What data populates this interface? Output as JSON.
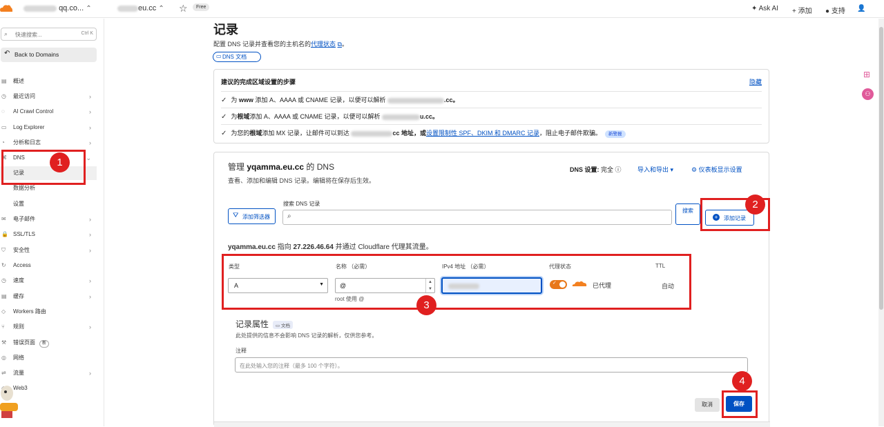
{
  "topbar": {
    "account": "qq.co...",
    "zone": "eu.cc",
    "free_badge": "Free",
    "ask_ai": "Ask AI",
    "add": "添加",
    "support": "支持"
  },
  "sidebar": {
    "search_placeholder": "快速搜索...",
    "search_shortcut": "Ctrl K",
    "back": "Back to Domains",
    "items": [
      {
        "label": "概述"
      },
      {
        "label": "最近访问"
      },
      {
        "label": "AI Crawl Control"
      },
      {
        "label": "Log Explorer"
      },
      {
        "label": "分析和日志"
      },
      {
        "label": "DNS"
      },
      {
        "label": "记录"
      },
      {
        "label": "数据分析"
      },
      {
        "label": "设置"
      },
      {
        "label": "电子邮件"
      },
      {
        "label": "SSL/TLS"
      },
      {
        "label": "安全性"
      },
      {
        "label": "Access"
      },
      {
        "label": "速度"
      },
      {
        "label": "缓存"
      },
      {
        "label": "Workers 路由"
      },
      {
        "label": "规则"
      },
      {
        "label": "错误页面"
      },
      {
        "label": "网络"
      },
      {
        "label": "流量"
      },
      {
        "label": "Web3"
      }
    ],
    "error_page_badge": "新"
  },
  "annotations": [
    "1",
    "2",
    "3",
    "4"
  ],
  "page": {
    "title": "记录",
    "desc_prefix": "配置 DNS 记录并查看您的主机名的",
    "desc_link": "代理状态",
    "desc_suffix": "。",
    "doc_btn": "DNS 文档"
  },
  "setup": {
    "heading": "建议的完成区域设置的步骤",
    "hide": "隐藏",
    "step1_a": "为",
    "step1_b": "www",
    "step1_c": "添加 A、AAAA 或 CNAME 记录，以便可以解析",
    "step1_d": ".cc。",
    "step2_a": "为",
    "step2_b": "根域",
    "step2_c": "添加 A、AAAA 或 CNAME 记录，以便可以解析",
    "step2_d": "u.cc。",
    "step3_a": "为您的",
    "step3_b": "根域",
    "step3_c": "添加 MX 记录，让邮件可以到达",
    "step3_d": "cc 地址，或",
    "step3_link": "设置限制性 SPF、DKIM 和 DMARC 记录",
    "step3_e": "，阻止电子邮件欺骗。",
    "new_badge": "新警报"
  },
  "manage": {
    "title_prefix": "管理",
    "domain": "yqamma.eu.cc",
    "title_suffix": "的 DNS",
    "desc": "查看、添加和编辑 DNS 记录。编辑将在保存后生效。",
    "dns_setting_label": "DNS 设置:",
    "dns_setting_value": "完全",
    "import_export": "导入和导出",
    "dashboard_settings": "仪表板显示设置",
    "filter_btn": "添加筛选器",
    "search_label": "搜索 DNS 记录",
    "search_btn": "搜索",
    "add_record": "添加记录",
    "points_domain": "yqamma.eu.cc",
    "points_mid": "指向",
    "points_ip": "27.226.46.64",
    "points_suffix": "并通过 Cloudflare 代理其流量。"
  },
  "form": {
    "col_type": "类型",
    "col_name": "名称 （必需）",
    "col_ipv4": "IPv4 地址 （必需）",
    "col_proxy": "代理状态",
    "col_ttl": "TTL",
    "type_value": "A",
    "name_value": "@",
    "root_hint": "root 使用 @",
    "proxy_value": "已代理",
    "ttl_value": "自动"
  },
  "attrs": {
    "title": "记录属性",
    "doc": "文档",
    "desc": "此处提供的信息不会影响 DNS 记录的解析，仅供您参考。",
    "note_label": "注释",
    "note_placeholder": "在此处输入您的注释（最多 100 个字符）。",
    "cancel": "取消",
    "save": "保存"
  },
  "colors": {
    "accent": "#0051c3",
    "annotation": "#e02020",
    "proxy_orange": "#e8781a"
  }
}
